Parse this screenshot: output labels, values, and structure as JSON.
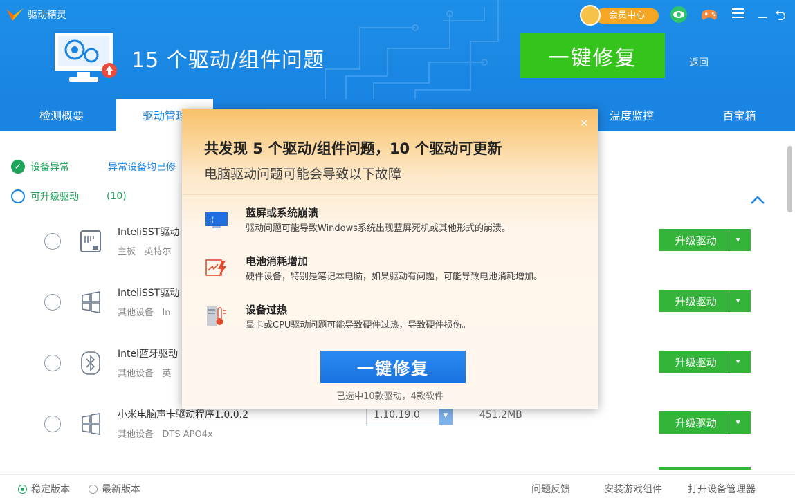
{
  "app": {
    "name": "驱动精灵"
  },
  "header": {
    "headline": "15 个驱动/组件问题",
    "fix_button": "一键修复",
    "back_link": "返回",
    "vip_label": "会员中心"
  },
  "tabs": [
    {
      "label": "检测概要"
    },
    {
      "label": "驱动管理"
    },
    {
      "label": "温度监控"
    },
    {
      "label": "百宝箱"
    }
  ],
  "status": {
    "device_abnormal": "设备异常",
    "device_abnormal_note": "异常设备均已修",
    "upgradable": "可升级驱动",
    "upgradable_count": "(10)"
  },
  "drivers": [
    {
      "name": "InteliSST驱动",
      "category": "主板",
      "vendor": "英特尔",
      "icon": "chip-icon",
      "button": "升级驱动"
    },
    {
      "name": "InteliSST驱动",
      "category": "其他设备",
      "vendor": "In",
      "icon": "windows-icon",
      "button": "升级驱动"
    },
    {
      "name": "Intel蓝牙驱动",
      "category": "其他设备",
      "vendor": "英",
      "icon": "bluetooth-icon",
      "button": "升级驱动"
    },
    {
      "name": "小米电脑声卡驱动程序1.0.0.2",
      "category": "其他设备",
      "vendor": "DTS APO4x",
      "icon": "windows-icon",
      "button": "升级驱动",
      "version": "1.10.19.0",
      "size": "451.2MB"
    }
  ],
  "footer": {
    "stable": "稳定版本",
    "latest": "最新版本",
    "feedback": "问题反馈",
    "install_game": "安装游戏组件",
    "device_manager": "打开设备管理器"
  },
  "modal": {
    "close": "×",
    "title": "共发现 5 个驱动/组件问题，10 个驱动可更新",
    "subtitle": "电脑驱动问题可能会导致以下故障",
    "issues": [
      {
        "title": "蓝屏或系统崩溃",
        "desc": "驱动问题可能导致Windows系统出现蓝屏死机或其他形式的崩溃。",
        "icon": "bluescreen-icon"
      },
      {
        "title": "电池消耗增加",
        "desc": "硬件设备，特别是笔记本电脑，如果驱动有问题，可能导致电池消耗增加。",
        "icon": "battery-icon"
      },
      {
        "title": "设备过热",
        "desc": "显卡或CPU驱动问题可能导致硬件过热，导致硬件损伤。",
        "icon": "thermometer-icon"
      }
    ],
    "fix_button": "一键修复",
    "selection_note": "已选中10款驱动，4款软件"
  }
}
